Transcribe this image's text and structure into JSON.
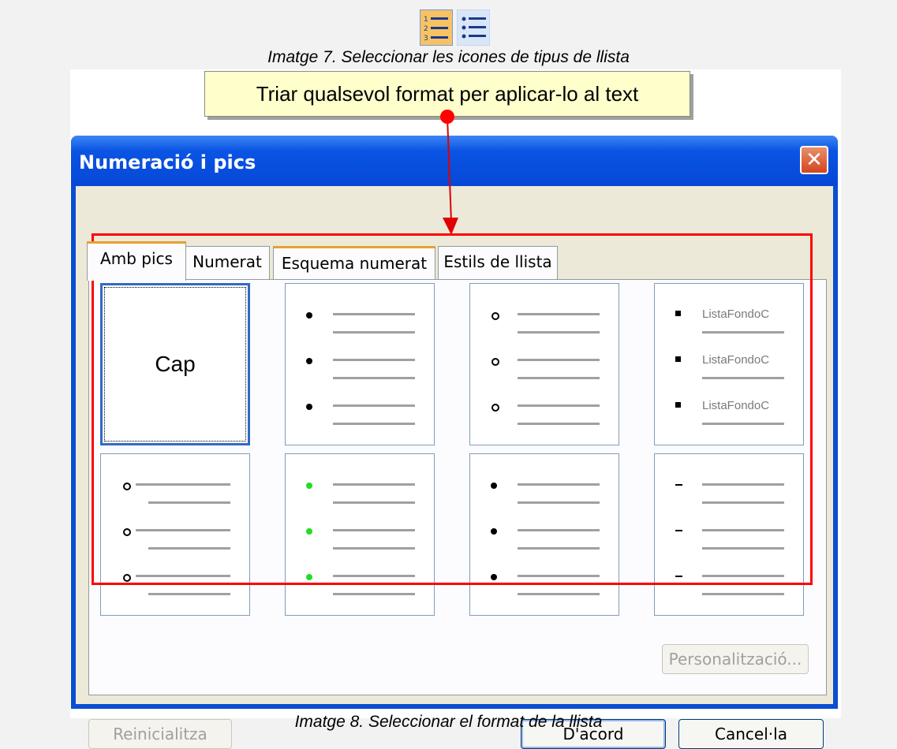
{
  "caption_top": "Imatge 7. Seleccionar les icones de tipus de llista",
  "caption_bottom": "Imatge 8. Seleccionar el format de la llista",
  "tooltip": "Triar qualsevol format per aplicar-lo al text",
  "dialog": {
    "title": "Numeració i pics",
    "close_symbol": "✕",
    "tabs": [
      {
        "label": "Amb pics",
        "active": true
      },
      {
        "label": "Numerat"
      },
      {
        "label": "Esquema numerat"
      },
      {
        "label": "Estils de llista"
      }
    ],
    "options": {
      "none_label": "Cap",
      "style_label": "ListaFondoC"
    },
    "buttons": {
      "customize": "Personalització...",
      "reset": "Reinicialitza",
      "ok": "D'acord",
      "cancel": "Cancel·la"
    }
  },
  "colors": {
    "accent_red": "#ff0000",
    "title_blue": "#0a54e4",
    "green_bullet": "#22dd22"
  }
}
